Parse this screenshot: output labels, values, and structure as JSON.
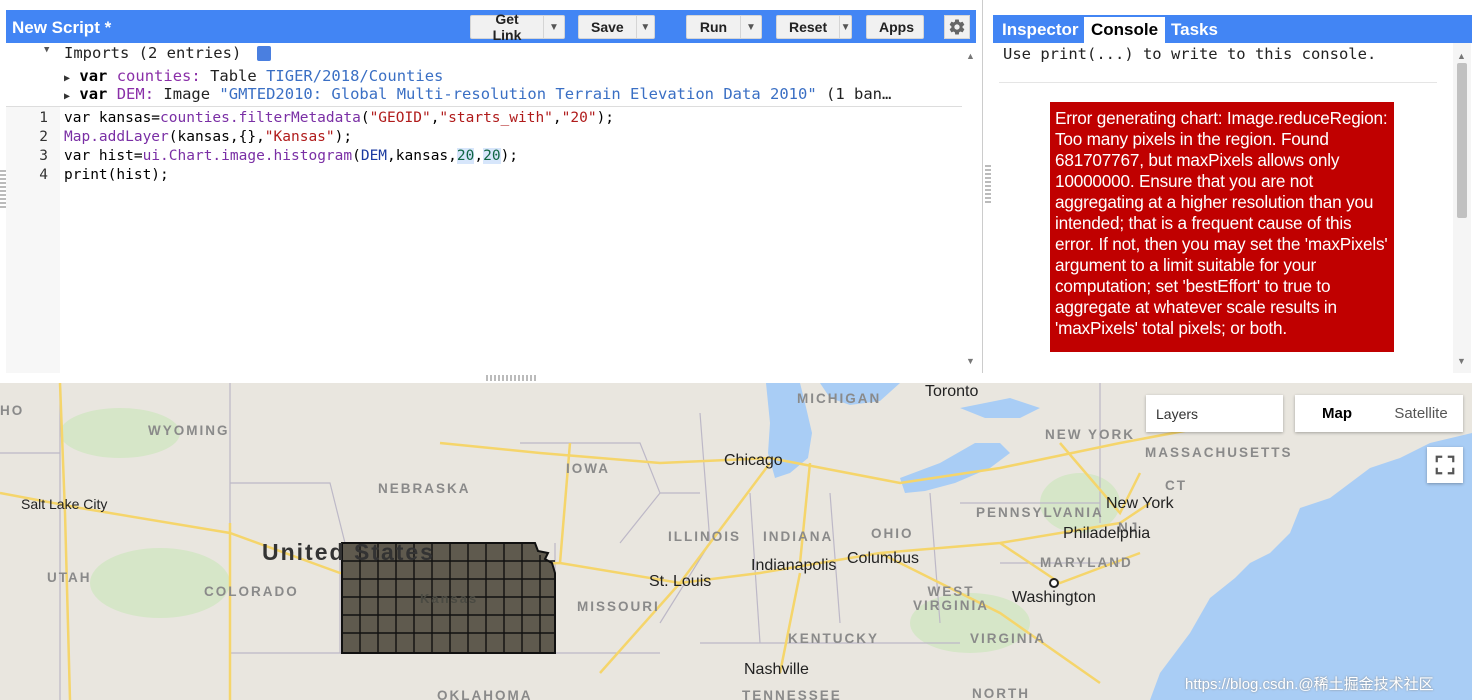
{
  "editor": {
    "title": "New Script *",
    "toolbar": {
      "get_link": "Get Link",
      "save": "Save",
      "run": "Run",
      "reset": "Reset",
      "apps": "Apps"
    },
    "imports": {
      "header": "Imports (2 entries)",
      "entries": [
        {
          "keyword": "var",
          "name": "counties",
          "type": "Table",
          "id": "TIGER/2018/Counties"
        },
        {
          "keyword": "var",
          "name": "DEM",
          "type": "Image",
          "id": "\"GMTED2010: Global Multi-resolution Terrain Elevation Data 2010\"",
          "extra": "(1 ban…"
        }
      ]
    },
    "lines": [
      "1",
      "2",
      "3",
      "4"
    ],
    "code": {
      "l1": {
        "kw": "var",
        "rest": " kansas=",
        "fn": "counties.filterMetadata",
        "open": "(",
        "s1": "\"GEOID\"",
        "c1": ",",
        "s2": "\"starts_with\"",
        "c2": ",",
        "s3": "\"20\"",
        "close": ");"
      },
      "l2": {
        "fn": "Map.addLayer",
        "a": "(kansas,{},",
        "s": "\"Kansas\"",
        "close": ");"
      },
      "l3": {
        "kw": "var",
        "rest": " hist=",
        "fn": "ui.Chart.image.histogram",
        "a": "(",
        "v": "DEM",
        "b": ",kansas,",
        "n1": "20",
        "c": ",",
        "n2": "20",
        "close": ");"
      },
      "l4": {
        "text": "print(hist);"
      }
    }
  },
  "right_panel": {
    "tabs": [
      "Inspector",
      "Console",
      "Tasks"
    ],
    "active_tab": "Console",
    "console_hint": "Use print(...) to write to this console.",
    "error_message": "Error generating chart: Image.reduceRegion: Too many pixels in the region. Found 681707767, but maxPixels allows only 10000000. Ensure that you are not aggregating at a higher resolution than you intended; that is a frequent cause of this error. If not, then you may set the 'maxPixels' argument to a limit suitable for your computation; set 'bestEffort' to true to aggregate at whatever scale results in 'maxPixels' total pixels; or both."
  },
  "map": {
    "layers_label": "Layers",
    "map_type": {
      "map": "Map",
      "satellite": "Satellite",
      "selected": "Map"
    },
    "country_label": "United States",
    "overlay_label": "Kansas",
    "states": [
      "HO",
      "WYOMING",
      "NEBRASKA",
      "IOWA",
      "MICHIGAN",
      "ILLINOIS",
      "INDIANA",
      "OHIO",
      "UTAH",
      "COLORADO",
      "MISSOURI",
      "KENTUCKY",
      "WEST VIRGINIA",
      "VIRGINIA",
      "PENNSYLVANIA",
      "NEW YORK",
      "MASSACHUSETTS",
      "CT",
      "NJ",
      "MARYLAND",
      "OKLAHOMA",
      "TENNESSEE",
      "NORTH"
    ],
    "cities": [
      "Salt Lake City",
      "Chicago",
      "Toronto",
      "St. Louis",
      "Indianapolis",
      "Columbus",
      "Nashville",
      "Philadelphia",
      "New York",
      "Washington"
    ],
    "watermark": "https://blog.csdn.@稀土掘金技术社区",
    "colors": {
      "water": "#a9cdf5",
      "land": "#e9e6df",
      "highway": "#f5d56b",
      "overlay": "#5f5a4e"
    }
  }
}
